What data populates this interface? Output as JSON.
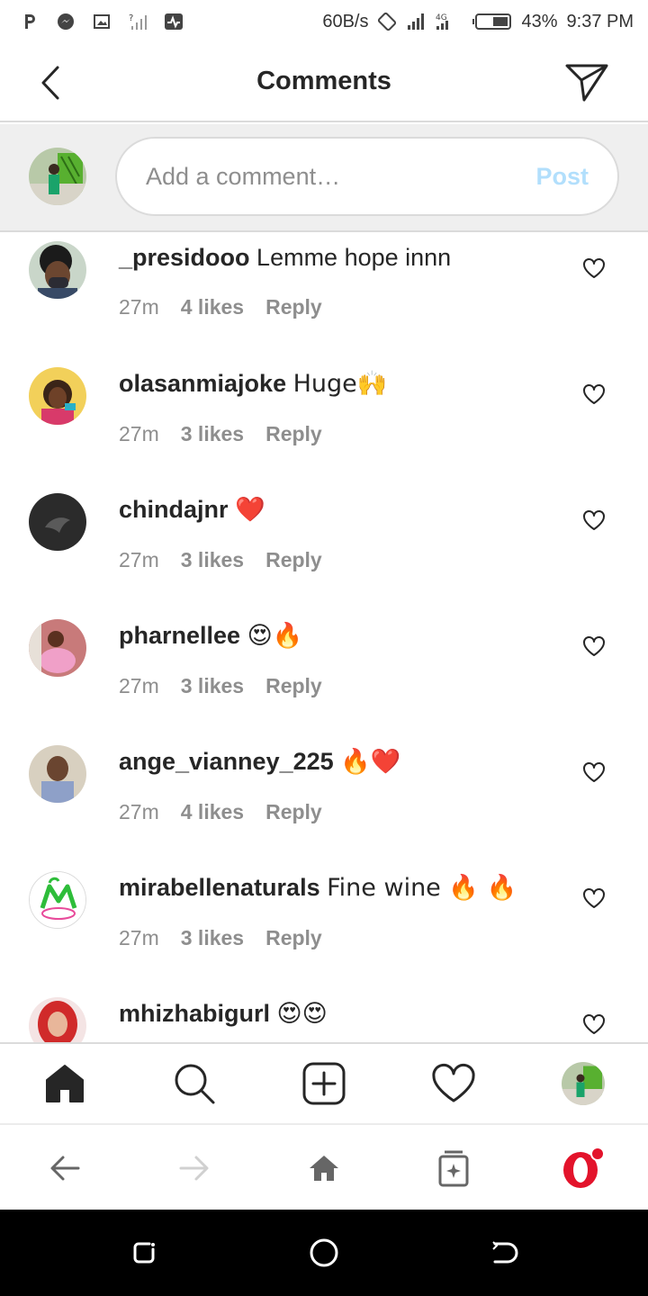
{
  "status_bar": {
    "speed": "60B/s",
    "network_label": "4G",
    "battery": "43%",
    "time": "9:37 PM"
  },
  "header": {
    "title": "Comments"
  },
  "comment_input": {
    "placeholder": "Add a comment…",
    "post_label": "Post"
  },
  "comments": [
    {
      "username": "_presidooo",
      "text": "Lemme hope innn",
      "time": "27m",
      "likes": "4 likes",
      "reply": "Reply"
    },
    {
      "username": "olasanmiajoke",
      "text": "Huge🙌",
      "time": "27m",
      "likes": "3 likes",
      "reply": "Reply"
    },
    {
      "username": "chindajnr",
      "text": "❤️",
      "time": "27m",
      "likes": "3 likes",
      "reply": "Reply"
    },
    {
      "username": "pharnellee",
      "text": "😍🔥",
      "time": "27m",
      "likes": "3 likes",
      "reply": "Reply"
    },
    {
      "username": "ange_vianney_225",
      "text": "🔥❤️",
      "time": "27m",
      "likes": "4 likes",
      "reply": "Reply"
    },
    {
      "username": "mirabellenaturals",
      "text": "Fine wine 🔥 🔥",
      "time": "27m",
      "likes": "3 likes",
      "reply": "Reply"
    },
    {
      "username": "mhizhabigurl",
      "text": "😍😍",
      "time": "",
      "likes": "",
      "reply": ""
    }
  ],
  "colors": {
    "post_button": "#b2dffc",
    "meta_text": "#8e8e8e",
    "opera_red": "#e3132b"
  },
  "icons": {
    "tabs": [
      "home-icon",
      "search-icon",
      "new-post-icon",
      "activity-heart-icon",
      "profile-avatar"
    ],
    "browser": [
      "back-arrow-icon",
      "forward-arrow-icon",
      "home-icon",
      "tabs-icon",
      "opera-icon"
    ]
  }
}
